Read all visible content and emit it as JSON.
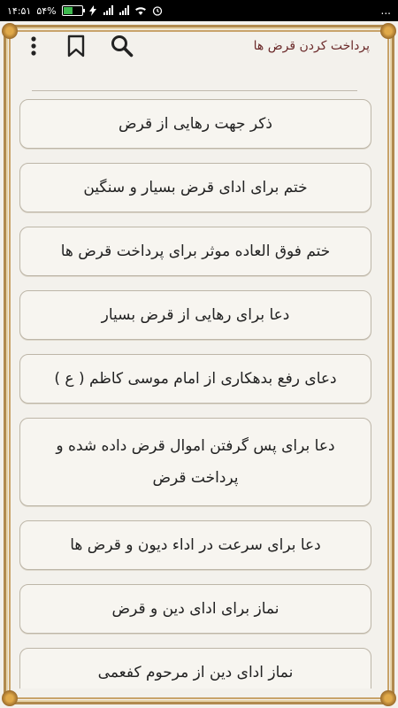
{
  "status": {
    "time": "۱۴:۵۱",
    "battery_percent": "۵۴%",
    "battery_level": 0.54,
    "more": "..."
  },
  "header": {
    "title": "پرداخت کردن قرض ها",
    "icons": [
      "more-vert-icon",
      "bookmark-icon",
      "search-icon"
    ]
  },
  "items": [
    "ذکر جهت رهایی از قرض",
    "ختم برای ادای قرض بسیار و سنگین",
    "ختم فوق العاده موثر برای پرداخت قرض ها",
    "دعا برای رهایی از قرض بسیار",
    "دعای رفع بدهکاری از امام موسی کاظم ( ع )",
    "دعا برای پس گرفتن اموال قرض داده شده و پرداخت قرض",
    "دعا برای سرعت در اداء دیون و قرض ها",
    "نماز برای ادای دین و قرض",
    "نماز ادای دین از مرحوم کفعمی"
  ]
}
